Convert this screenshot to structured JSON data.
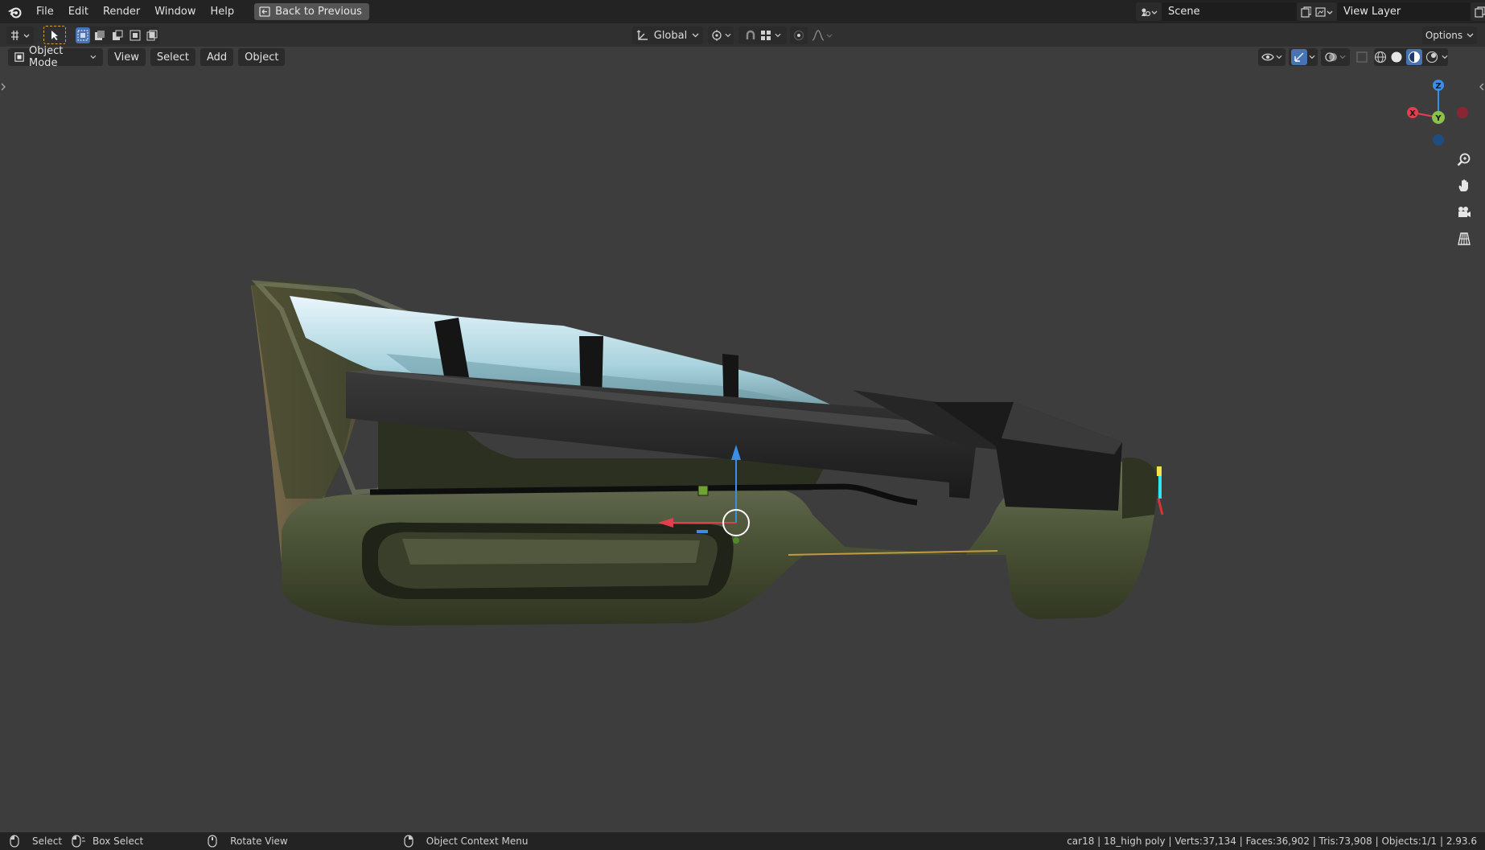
{
  "menu": {
    "items": [
      "File",
      "Edit",
      "Render",
      "Window",
      "Help"
    ],
    "back_label": "Back to Previous"
  },
  "scene": {
    "label": "Scene"
  },
  "view_layer": {
    "label": "View Layer"
  },
  "header": {
    "orientation": "Global",
    "options_label": "Options"
  },
  "viewport_header": {
    "mode": "Object Mode",
    "menus": [
      "View",
      "Select",
      "Add",
      "Object"
    ]
  },
  "gizmo": {
    "x": "X",
    "y": "Y",
    "z": "Z"
  },
  "statusbar": {
    "select": "Select",
    "box_select": "Box Select",
    "rotate": "Rotate View",
    "context": "Object Context Menu",
    "stats": "car18 | 18_high poly | Verts:37,134 | Faces:36,902 | Tris:73,908 | Objects:1/1 | 2.93.6"
  },
  "colors": {
    "topbar": "#232323",
    "viewport": "#3d3d3d",
    "axis_x": "#e0404e",
    "axis_y": "#8bc34a",
    "axis_z": "#3b8ee6",
    "active_blue": "#4772b3"
  }
}
